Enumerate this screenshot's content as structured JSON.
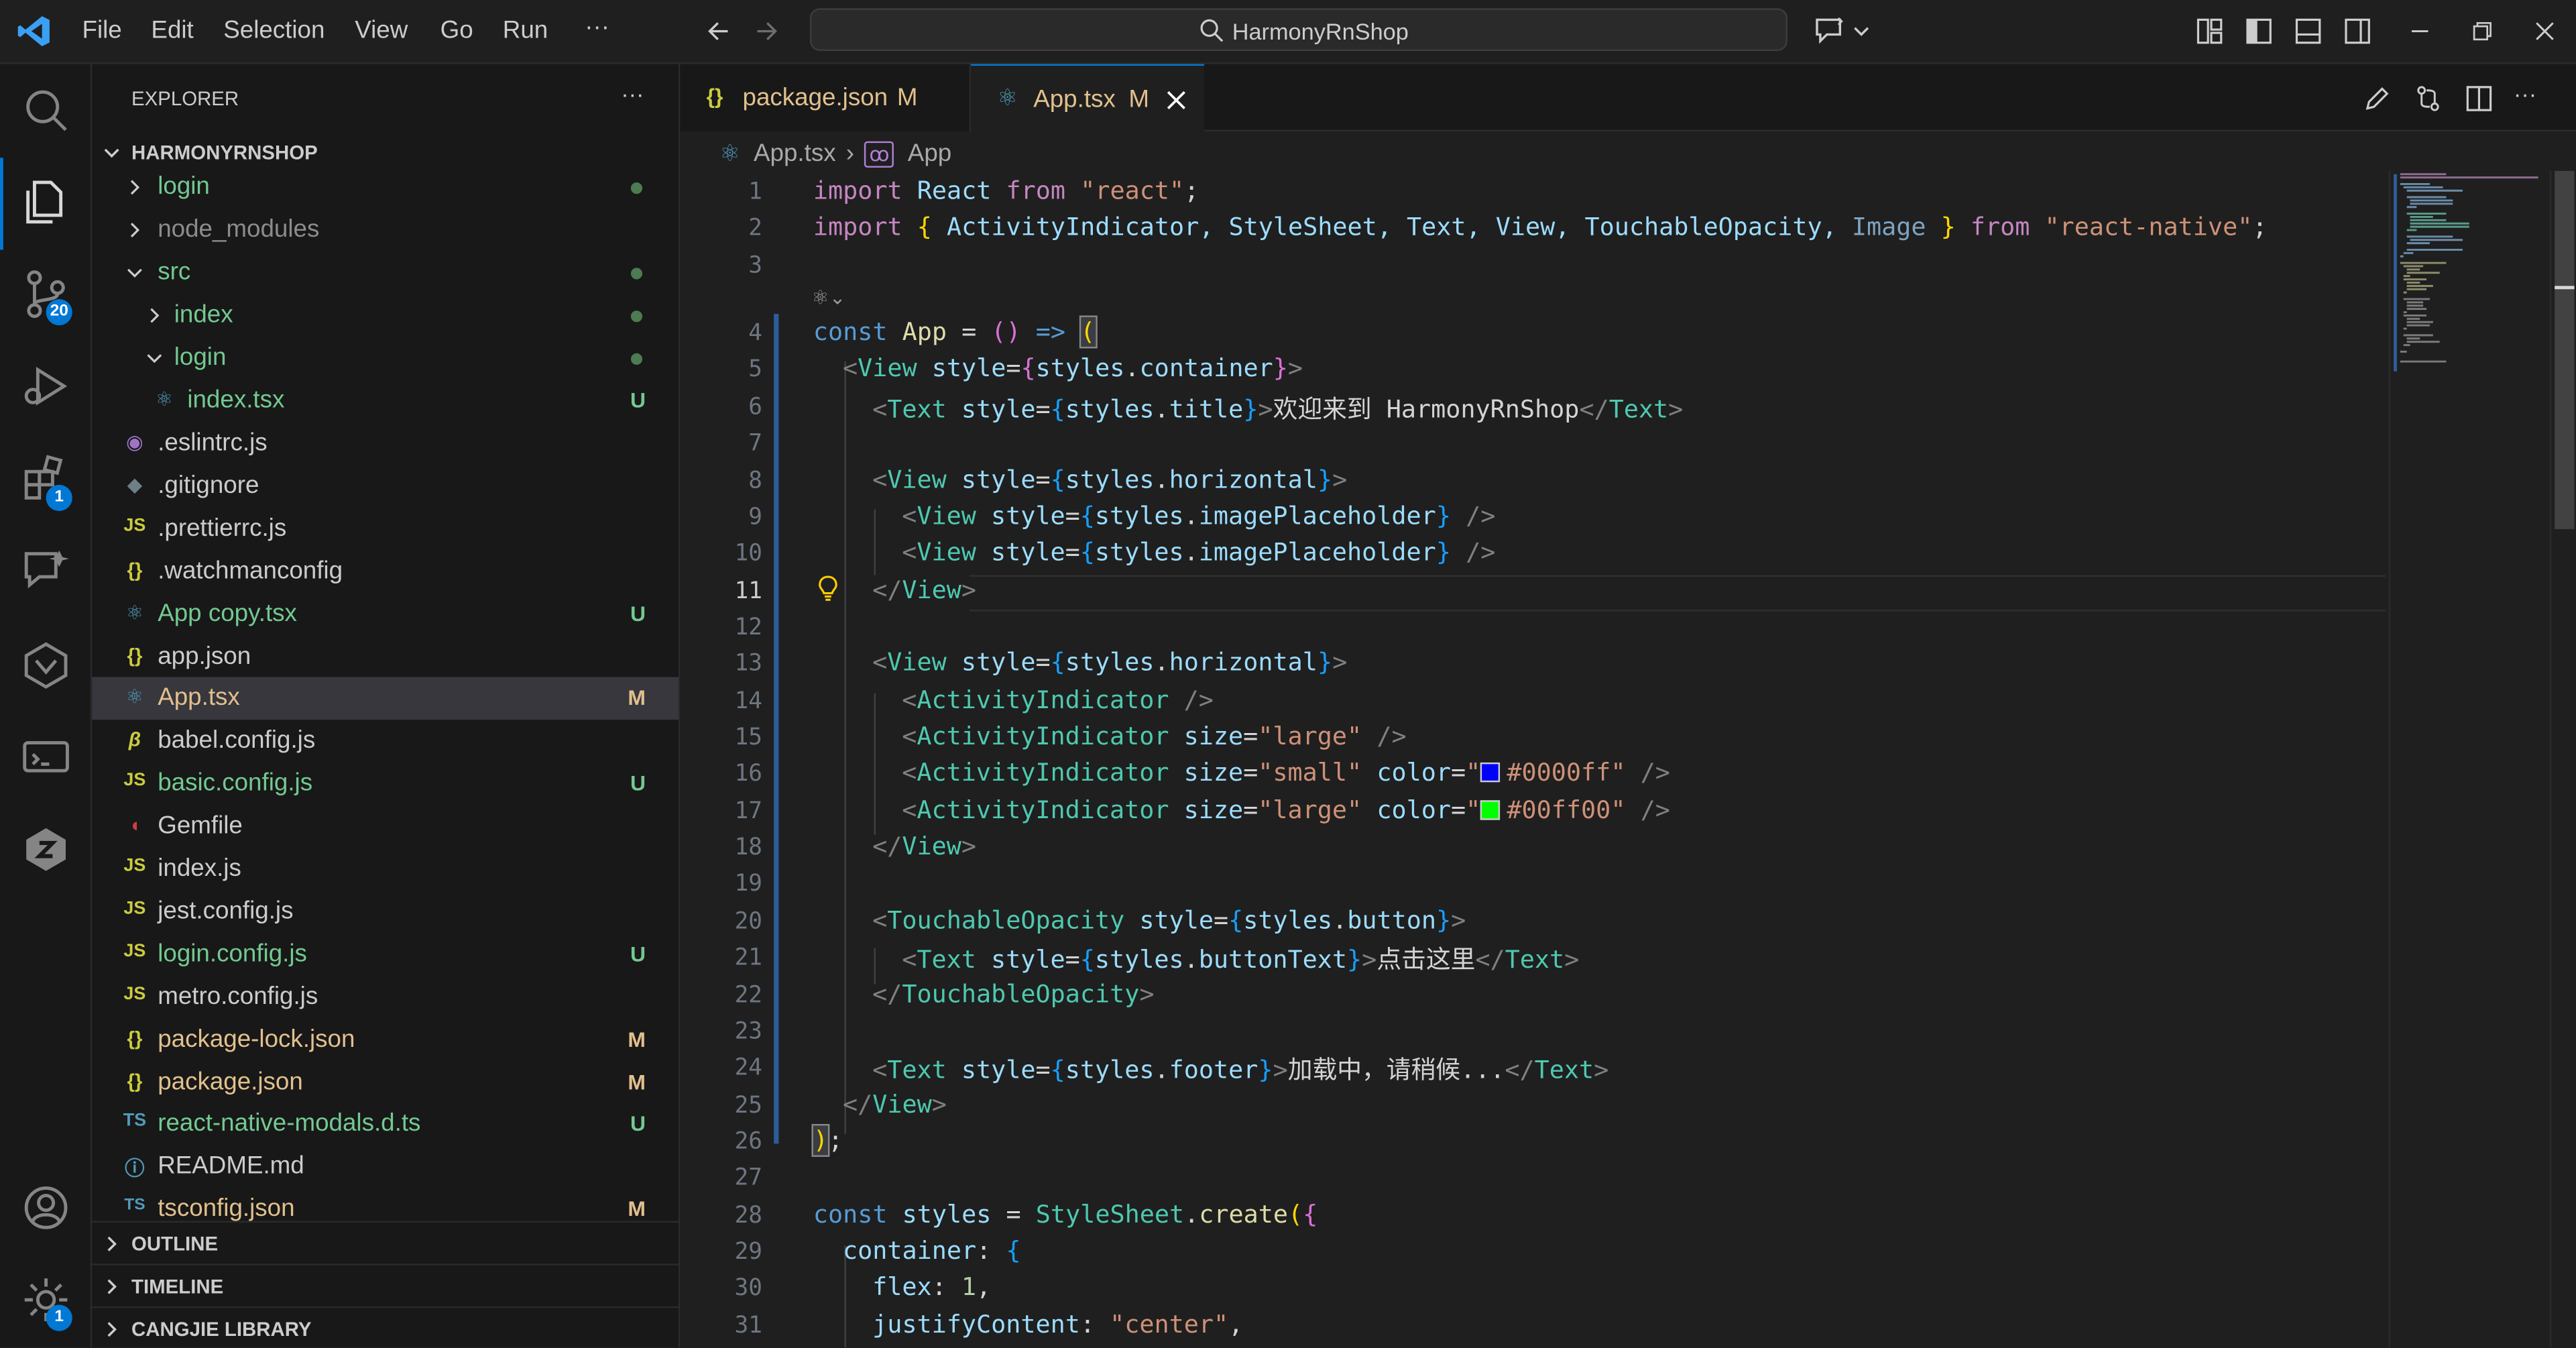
{
  "titlebar": {
    "menu": [
      "File",
      "Edit",
      "Selection",
      "View",
      "Go",
      "Run",
      "···"
    ],
    "search": "HarmonyRnShop"
  },
  "activity": {
    "scm_badge": "20",
    "extensions_badge": "1",
    "settings_badge": "1"
  },
  "sidebar": {
    "title": "EXPLORER",
    "more": "···",
    "root": "HARMONYRNSHOP",
    "items": [
      {
        "name": "login",
        "status": "dot"
      },
      {
        "name": "node_modules",
        "status": ""
      },
      {
        "name": "src",
        "status": "dot"
      },
      {
        "name": "index",
        "status": "dot"
      },
      {
        "name": "login",
        "status": "dot"
      },
      {
        "name": "index.tsx",
        "status": "U"
      },
      {
        "name": ".eslintrc.js",
        "status": ""
      },
      {
        "name": ".gitignore",
        "status": ""
      },
      {
        "name": ".prettierrc.js",
        "status": ""
      },
      {
        "name": ".watchmanconfig",
        "status": ""
      },
      {
        "name": "App copy.tsx",
        "status": "U"
      },
      {
        "name": "app.json",
        "status": ""
      },
      {
        "name": "App.tsx",
        "status": "M"
      },
      {
        "name": "babel.config.js",
        "status": ""
      },
      {
        "name": "basic.config.js",
        "status": "U"
      },
      {
        "name": "Gemfile",
        "status": ""
      },
      {
        "name": "index.js",
        "status": ""
      },
      {
        "name": "jest.config.js",
        "status": ""
      },
      {
        "name": "login.config.js",
        "status": "U"
      },
      {
        "name": "metro.config.js",
        "status": ""
      },
      {
        "name": "package-lock.json",
        "status": "M"
      },
      {
        "name": "package.json",
        "status": "M"
      },
      {
        "name": "react-native-modals.d.ts",
        "status": "U"
      },
      {
        "name": "README.md",
        "status": ""
      },
      {
        "name": "tsconfig.json",
        "status": "M"
      }
    ],
    "sections": [
      "OUTLINE",
      "TIMELINE",
      "CANGJIE LIBRARY"
    ]
  },
  "tabs": [
    {
      "label": "package.json",
      "status": "M"
    },
    {
      "label": "App.tsx",
      "status": "M"
    }
  ],
  "breadcrumb": [
    "App.tsx",
    "App"
  ],
  "editor": {
    "line_numbers": [
      "1",
      "2",
      "3",
      "4",
      "5",
      "6",
      "7",
      "8",
      "9",
      "10",
      "11",
      "12",
      "13",
      "14",
      "15",
      "16",
      "17",
      "18",
      "19",
      "20",
      "21",
      "22",
      "23",
      "24",
      "25",
      "26",
      "27",
      "28",
      "29",
      "30",
      "31"
    ],
    "code": {
      "l1": [
        "import",
        "React",
        "from",
        "\"react\"",
        ";"
      ],
      "l2": [
        "import",
        "{",
        "ActivityIndicator, StyleSheet, Text, View, TouchableOpacity,",
        "Image",
        "}",
        "from",
        "\"react-native\"",
        ";"
      ],
      "l4": [
        "const",
        "App",
        "=",
        "()",
        "=>",
        "("
      ],
      "l5": [
        "<",
        "View",
        "style",
        "=",
        "{",
        "styles",
        ".",
        "container",
        "}",
        ">"
      ],
      "l6": [
        "<",
        "Text",
        "style",
        "=",
        "{",
        "styles",
        ".",
        "title",
        "}",
        ">",
        "欢迎来到 HarmonyRnShop",
        "</",
        "Text",
        ">"
      ],
      "l8": [
        "<",
        "View",
        "style",
        "=",
        "{",
        "styles",
        ".",
        "horizontal",
        "}",
        ">"
      ],
      "l9": [
        "<",
        "View",
        "style",
        "=",
        "{",
        "styles",
        ".",
        "imagePlaceholder",
        "}",
        "/>"
      ],
      "l10": [
        "<",
        "View",
        "style",
        "=",
        "{",
        "styles",
        ".",
        "imagePlaceholder",
        "}",
        "/>"
      ],
      "l11": [
        "</",
        "View",
        ">"
      ],
      "l13": [
        "<",
        "View",
        "style",
        "=",
        "{",
        "styles",
        ".",
        "horizontal",
        "}",
        ">"
      ],
      "l14": [
        "<",
        "ActivityIndicator",
        "/>"
      ],
      "l15": [
        "<",
        "ActivityIndicator",
        "size",
        "=",
        "\"large\"",
        "/>"
      ],
      "l16": [
        "<",
        "ActivityIndicator",
        "size",
        "=",
        "\"small\"",
        "color",
        "=",
        "\"",
        "#0000ff\"",
        "/>"
      ],
      "l17": [
        "<",
        "ActivityIndicator",
        "size",
        "=",
        "\"large\"",
        "color",
        "=",
        "\"",
        "#00ff00\"",
        "/>"
      ],
      "l18": [
        "</",
        "View",
        ">"
      ],
      "l20": [
        "<",
        "TouchableOpacity",
        "style",
        "=",
        "{",
        "styles",
        ".",
        "button",
        "}",
        ">"
      ],
      "l21": [
        "<",
        "Text",
        "style",
        "=",
        "{",
        "styles",
        ".",
        "buttonText",
        "}",
        ">",
        "点击这里",
        "</",
        "Text",
        ">"
      ],
      "l22": [
        "</",
        "TouchableOpacity",
        ">"
      ],
      "l24": [
        "<",
        "Text",
        "style",
        "=",
        "{",
        "styles",
        ".",
        "footer",
        "}",
        ">",
        "加载中，请稍候...",
        "</",
        "Text",
        ">"
      ],
      "l25": [
        "</",
        "View",
        ">"
      ],
      "l26": [
        ")",
        ";"
      ],
      "l28": [
        "const",
        "styles",
        "=",
        "StyleSheet",
        ".",
        "create",
        "(",
        "{"
      ],
      "l29": [
        "container",
        ":",
        "{"
      ],
      "l30": [
        "flex",
        ":",
        "1",
        ","
      ],
      "l31": [
        "justifyContent",
        ":",
        "\"center\"",
        ","
      ]
    },
    "current_line": "11",
    "swatch_blue": "#0000ff",
    "swatch_green": "#00ff00"
  }
}
